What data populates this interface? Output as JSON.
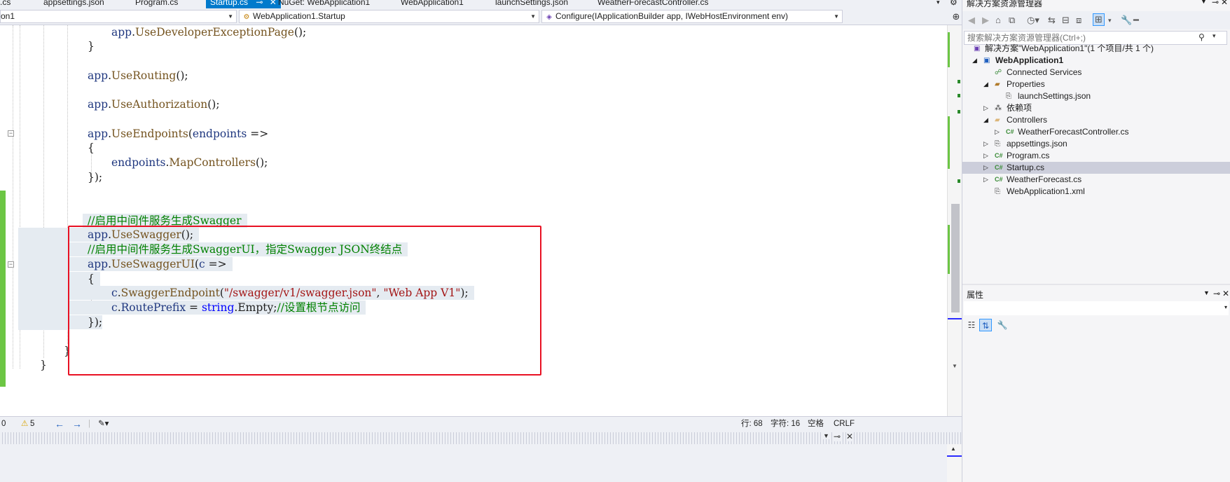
{
  "tabs": [
    {
      "label": ".cs"
    },
    {
      "label": "appsettings.json"
    },
    {
      "label": "Program.cs"
    },
    {
      "label": "Startup.cs",
      "active": true
    },
    {
      "label": "NuGet: WebApplication1"
    },
    {
      "label": "WebApplication1"
    },
    {
      "label": "launchSettings.json"
    },
    {
      "label": "WeatherForecastController.cs"
    }
  ],
  "navbar": {
    "project": "on1",
    "class": "WebApplication1.Startup",
    "member": "Configure(IApplicationBuilder app, IWebHostEnvironment env)"
  },
  "code": {
    "l1_obj": "app",
    "l1_m": "UseDeveloperExceptionPage",
    "l1_tail": "();",
    "l2": "}",
    "l3_obj": "app",
    "l3_m": "UseRouting",
    "l3_tail": "();",
    "l4_obj": "app",
    "l4_m": "UseAuthorization",
    "l4_tail": "();",
    "l5_obj": "app",
    "l5_m": "UseEndpoints",
    "l5_p": "(",
    "l5_arg": "endpoints",
    "l5_tail": " =>",
    "l6": "{",
    "l7_obj": "endpoints",
    "l7_m": "MapControllers",
    "l7_tail": "();",
    "l8": "});",
    "l9_comment": "//启用中间件服务生成Swagger",
    "l10_obj": "app",
    "l10_m": "UseSwagger",
    "l10_tail": "();",
    "l11_comment": "//启用中间件服务生成SwaggerUI，指定Swagger JSON终结点",
    "l12_obj": "app",
    "l12_m": "UseSwaggerUI",
    "l12_p": "(",
    "l12_arg": "c",
    "l12_tail": " =>",
    "l13": "{",
    "l14_obj": "c",
    "l14_m": "SwaggerEndpoint",
    "l14_p": "(",
    "l14_s1": "\"/swagger/v1/swagger.json\"",
    "l14_sep": ", ",
    "l14_s2": "\"Web App V1\"",
    "l14_tail": ");",
    "l15_obj": "c",
    "l15_prop": "RoutePrefix",
    "l15_eq": " = ",
    "l15_kw": "string",
    "l15_dot": ".",
    "l15_empty": "Empty",
    "l15_semi": ";",
    "l15_comment": "//设置根节点访问",
    "l16": "});",
    "l17": "}",
    "l18": "}"
  },
  "statusbar": {
    "zoom": "0",
    "warnings_icon": "⚠",
    "warnings": "5",
    "line": "行: 68",
    "col": "字符: 16",
    "indent": "空格",
    "eol": "CRLF"
  },
  "solution_explorer": {
    "title": "解决方案资源管理器",
    "search_placeholder": "搜索解决方案资源管理器(Ctrl+;)",
    "items": [
      {
        "label": "解决方案\"WebApplication1\"(1 个项目/共 1 个)",
        "icon": "solution-icon"
      },
      {
        "label": "WebApplication1",
        "icon": "csproj-icon",
        "bold": true
      },
      {
        "label": "Connected Services",
        "icon": "connected-services-icon"
      },
      {
        "label": "Properties",
        "icon": "properties-folder-icon"
      },
      {
        "label": "launchSettings.json",
        "icon": "json-file-icon"
      },
      {
        "label": "依赖项",
        "icon": "dependencies-icon"
      },
      {
        "label": "Controllers",
        "icon": "folder-icon"
      },
      {
        "label": "WeatherForecastController.cs",
        "icon": "csharp-file-icon"
      },
      {
        "label": "appsettings.json",
        "icon": "json-file-icon"
      },
      {
        "label": "Program.cs",
        "icon": "csharp-file-icon"
      },
      {
        "label": "Startup.cs",
        "icon": "csharp-file-icon",
        "selected": true
      },
      {
        "label": "WeatherForecast.cs",
        "icon": "csharp-file-icon"
      },
      {
        "label": "WebApplication1.xml",
        "icon": "xml-file-icon"
      }
    ]
  },
  "properties": {
    "title": "属性"
  },
  "colors": {
    "accent": "#007acc",
    "highlight_box": "#e81123",
    "keyword": "#0000ff",
    "comment": "#008000",
    "string": "#a31515",
    "method": "#74531f",
    "identifier": "#1f377f"
  }
}
